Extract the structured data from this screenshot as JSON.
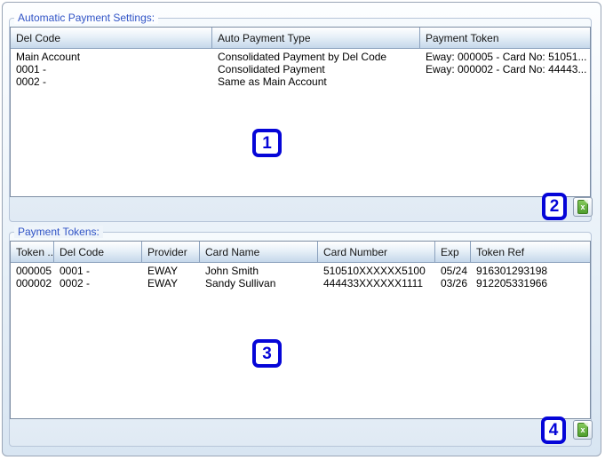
{
  "colors": {
    "callout_blue": "#0505d8",
    "group_label_blue": "#3054c6",
    "excel_icon_green": "#4f9e2d",
    "table_header_blue": "#c5d7ea"
  },
  "sections": {
    "auto_payment": {
      "title": "Automatic Payment Settings:",
      "columns": [
        "Del Code",
        "Auto Payment Type",
        "Payment Token"
      ],
      "rows": [
        [
          "Main Account",
          "Consolidated Payment by Del Code",
          "Eway: 000005 - Card No: 51051..."
        ],
        [
          "0001 -",
          "Consolidated Payment",
          "Eway: 000002 - Card No: 44443..."
        ],
        [
          "0002 -",
          "Same as Main Account",
          ""
        ]
      ],
      "export_icon": "excel-export"
    },
    "payment_tokens": {
      "title": "Payment Tokens:",
      "columns": [
        "Token ...",
        "Del Code",
        "Provider",
        "Card Name",
        "Card Number",
        "Exp",
        "Token Ref"
      ],
      "rows": [
        [
          "000005",
          "0001 -",
          "EWAY",
          "John Smith",
          "510510XXXXXX5100",
          "05/24",
          "916301293198"
        ],
        [
          "000002",
          "0002 -",
          "EWAY",
          "Sandy Sullivan",
          "444433XXXXXX1111",
          "03/26",
          "912205331966"
        ]
      ],
      "export_icon": "excel-export"
    }
  },
  "callouts": {
    "one": "1",
    "two": "2",
    "three": "3",
    "four": "4"
  },
  "excel_icon_letter": "x"
}
